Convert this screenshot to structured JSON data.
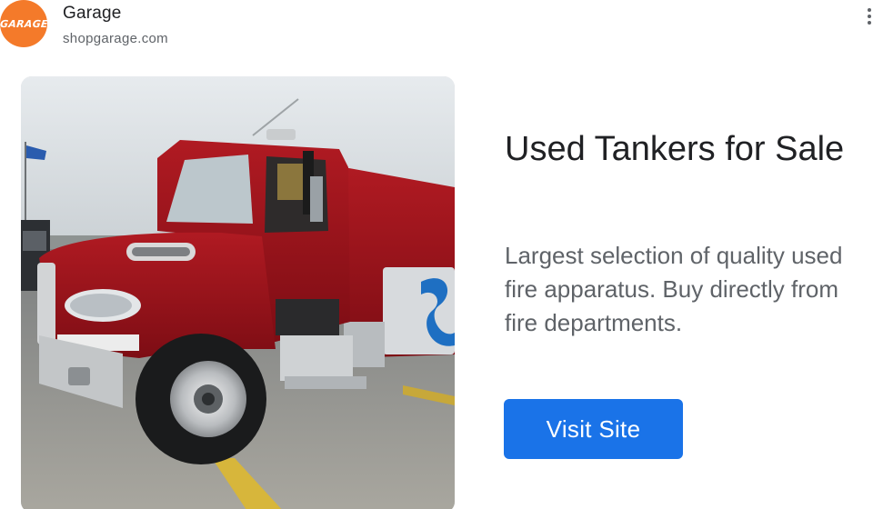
{
  "advertiser": {
    "logo_text": "GARAGE",
    "name": "Garage",
    "url": "shopgarage.com",
    "brand_color": "#f47a2a"
  },
  "menu": {
    "icon": "more-vert-icon"
  },
  "ad": {
    "image_alt": "Red used fire tanker truck parked on a wet lot",
    "headline": "Used Tankers for Sale",
    "description": "Largest selection of quality used fire apparatus. Buy directly from fire departments.",
    "cta_label": "Visit Site",
    "cta_color": "#1a73e8"
  }
}
